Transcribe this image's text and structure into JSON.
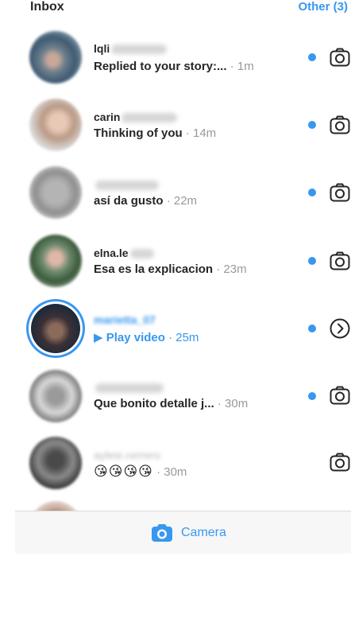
{
  "header": {
    "title": "Inbox",
    "other_link": "Other (3)"
  },
  "colors": {
    "accent": "#3897f0",
    "text": "#262626",
    "muted": "#999999"
  },
  "threads": [
    {
      "username": "lqli",
      "message": "Replied to your story:...",
      "time": "· 1m",
      "unread": true,
      "action_icon": "camera-icon"
    },
    {
      "username": "carin",
      "message": "Thinking of you",
      "time": "· 14m",
      "unread": true,
      "action_icon": "camera-icon"
    },
    {
      "username": "",
      "message": "así da gusto",
      "time": "· 22m",
      "unread": true,
      "action_icon": "camera-icon"
    },
    {
      "username": "elna.le",
      "message": "Esa es la explicacion",
      "time": "· 23m",
      "unread": true,
      "action_icon": "camera-icon"
    },
    {
      "username": "marietta_07",
      "message": "▶ Play video",
      "time": "· 25m",
      "unread": true,
      "action_icon": "chevron-right-icon",
      "has_story_ring": true
    },
    {
      "username": "",
      "message": "Que bonito detalle j...",
      "time": "· 30m",
      "unread": true,
      "action_icon": "camera-icon"
    },
    {
      "username": "aylesi.cerrero",
      "message": "😘😘😘😘",
      "time": "· 30m",
      "unread": false,
      "action_icon": "camera-icon"
    }
  ],
  "tabbar": {
    "camera_label": "Camera",
    "camera_icon": "camera-icon"
  }
}
